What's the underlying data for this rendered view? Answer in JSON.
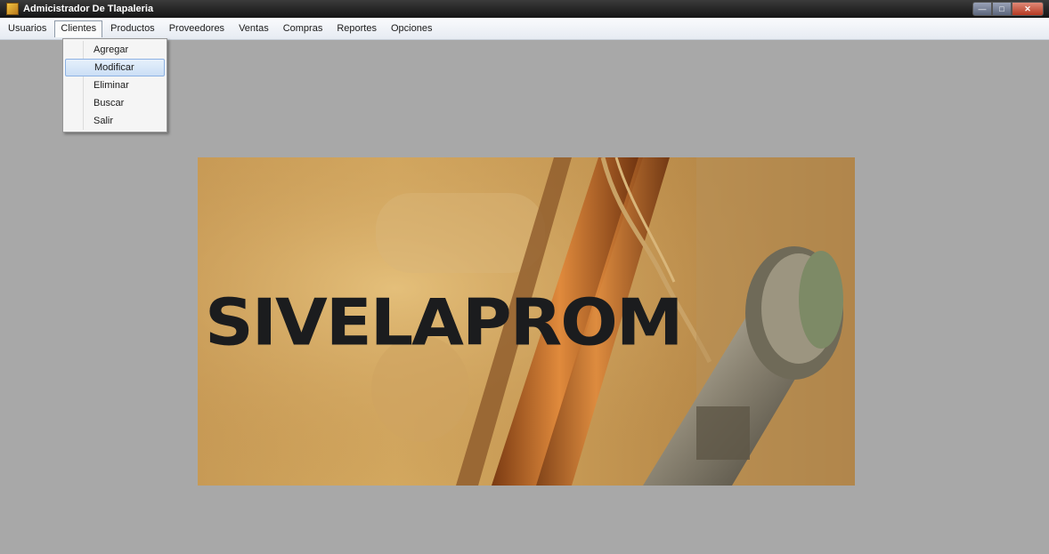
{
  "window": {
    "title": "Admicistrador De Tlapaleria"
  },
  "menu": {
    "items": [
      "Usuarios",
      "Clientes",
      "Productos",
      "Proveedores",
      "Ventas",
      "Compras",
      "Reportes",
      "Opciones"
    ],
    "active": "Clientes"
  },
  "dropdown": {
    "items": [
      "Agregar",
      "Modificar",
      "Eliminar",
      "Buscar",
      "Salir"
    ],
    "selected": "Modificar"
  },
  "banner": {
    "logo_text": "SIVELAPROM"
  },
  "colors": {
    "background": "#a8a8a8",
    "titlebar": "#141414",
    "highlight": "#cbdff6"
  },
  "icons": [
    "app-icon",
    "minimize-icon",
    "maximize-icon",
    "close-icon"
  ]
}
